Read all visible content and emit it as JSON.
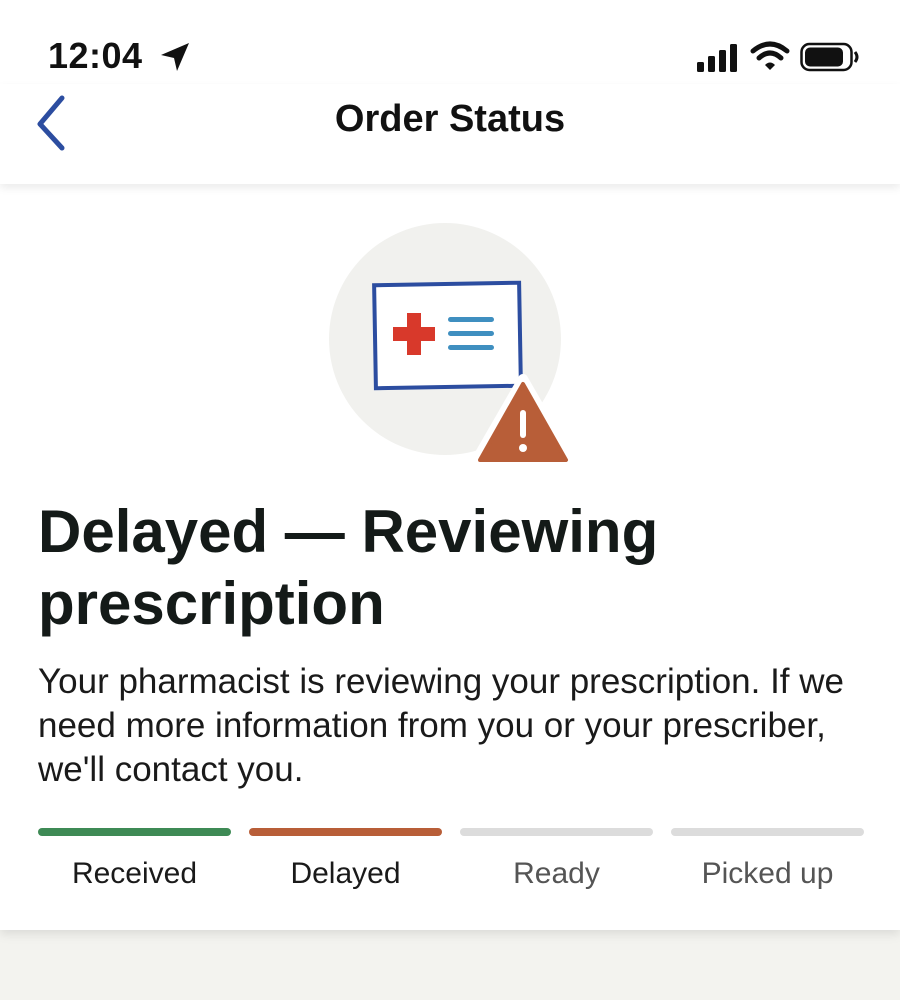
{
  "status_bar": {
    "time": "12:04",
    "icons": [
      "location-arrow-icon",
      "cellular-signal-icon",
      "wifi-icon",
      "battery-icon"
    ]
  },
  "nav": {
    "title": "Order Status",
    "back_icon": "chevron-left-icon"
  },
  "status": {
    "illustration_icons": [
      "prescription-card-icon",
      "warning-triangle-icon"
    ],
    "headline": "Delayed — Reviewing prescription",
    "description": "Your pharmacist is reviewing your prescription. If we need more information from you or your prescriber, we'll contact you."
  },
  "progress": {
    "steps": [
      {
        "label": "Received",
        "state": "complete",
        "color": "#3e8a55"
      },
      {
        "label": "Delayed",
        "state": "current",
        "color": "#b85e38"
      },
      {
        "label": "Ready",
        "state": "pending",
        "color": "#dcdcdc"
      },
      {
        "label": "Picked up",
        "state": "pending",
        "color": "#dcdcdc"
      }
    ]
  },
  "colors": {
    "accent_blue": "#2c4da0",
    "warning": "#b85e38",
    "cross_red": "#d8392b",
    "lines_blue": "#3f8fc0",
    "page_background": "#f3f3ef"
  }
}
